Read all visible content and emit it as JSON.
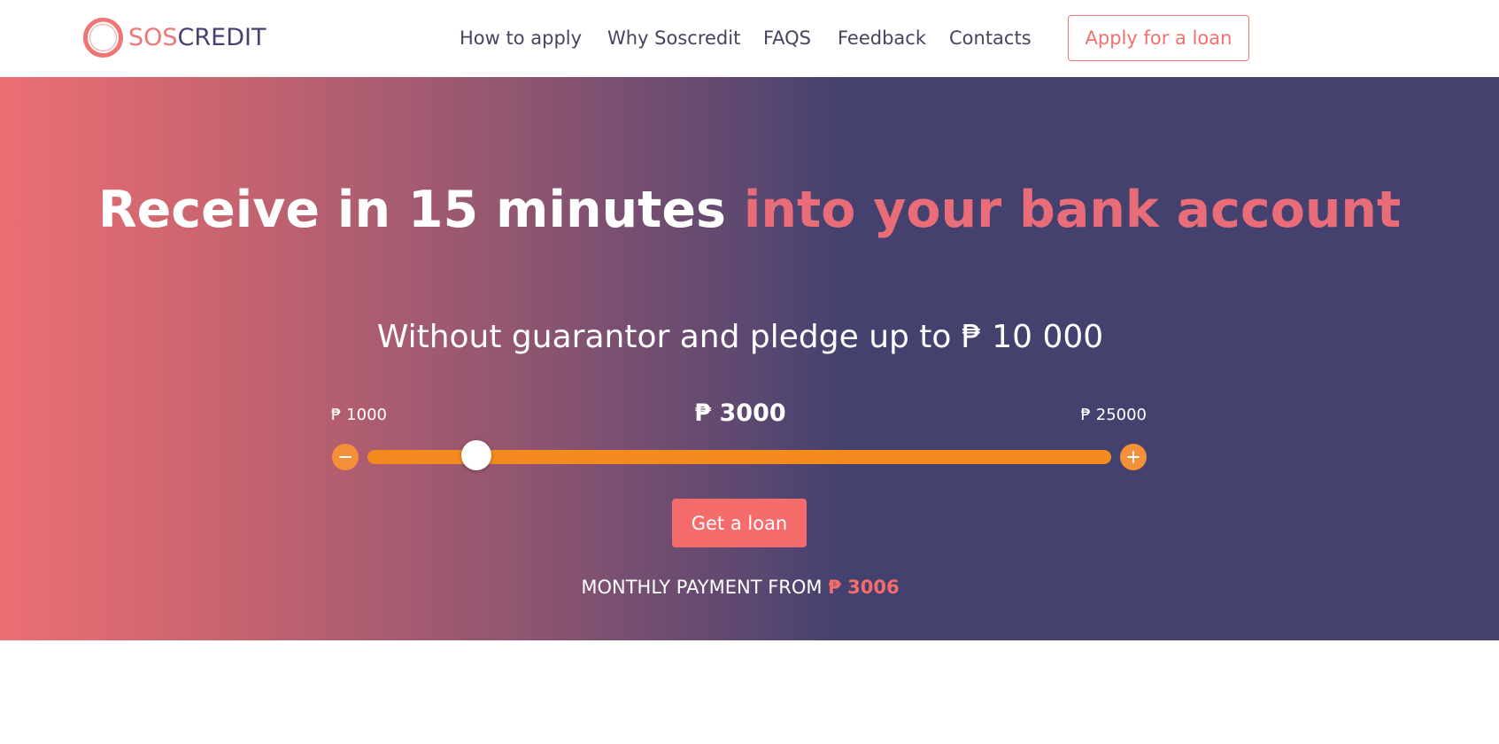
{
  "brand": {
    "logo_sos": "SOS",
    "logo_credit": "CREDIT",
    "accent_color": "#f07575",
    "dark_color": "#454272"
  },
  "nav": {
    "items": [
      {
        "label": "How to apply"
      },
      {
        "label": "Why Soscredit"
      },
      {
        "label": "FAQS"
      },
      {
        "label": "Feedback"
      },
      {
        "label": "Contacts"
      }
    ],
    "apply_label": "Apply for a loan"
  },
  "hero": {
    "title_white": "Receive in 15 minutes",
    "title_highlight": "into your bank account",
    "subtitle": "Without guarantor and pledge up to ₱ 10 000"
  },
  "calculator": {
    "currency": "₱",
    "min_label": "₱ 1000",
    "max_label": "₱ 25000",
    "current_label": "₱  3000",
    "min": 1000,
    "max": 25000,
    "value": 3000,
    "slider_color": "#f58a1f",
    "cta_label": "Get a loan",
    "monthly_prefix": "MONTHLY PAYMENT FROM",
    "monthly_amount": "₱ 3006"
  },
  "icons": {
    "minus": "minus-icon",
    "plus": "plus-icon",
    "logo": "ring-logo-icon"
  }
}
